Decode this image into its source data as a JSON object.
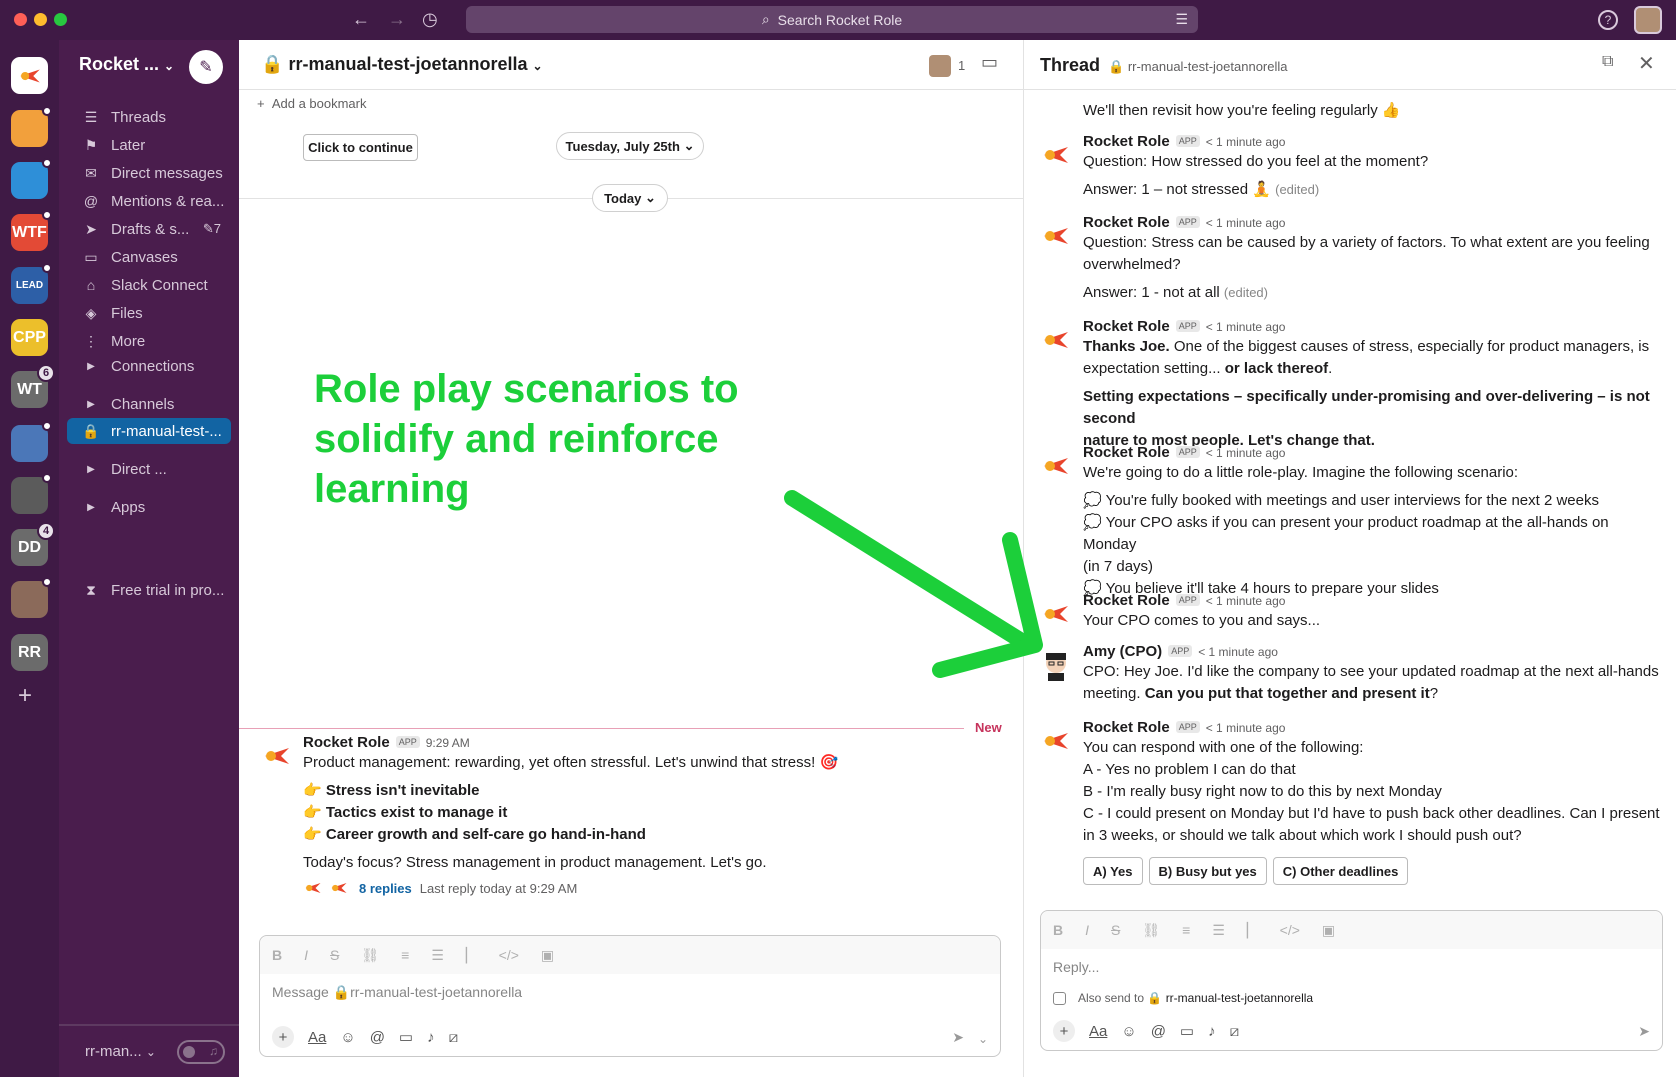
{
  "window": {
    "search_placeholder": "Search Rocket Role"
  },
  "rail": {
    "workspaces": [
      {
        "label": "",
        "color": "#d3382c"
      },
      {
        "label": "",
        "color": "#f2a03c"
      },
      {
        "label": "",
        "color": "#2e8fd8"
      },
      {
        "label": "WTF",
        "color": "#e34a36"
      },
      {
        "label": "LEAD",
        "color": "#2d5fa7"
      },
      {
        "label": "CPP",
        "color": "#ecbf2b"
      },
      {
        "label": "WT",
        "color": "#6b6b6b",
        "badge": "6"
      },
      {
        "label": "",
        "color": "#4b77b8"
      },
      {
        "label": "",
        "color": "#5b5b5b"
      },
      {
        "label": "DD",
        "color": "#6b6b6b",
        "badge": "4"
      },
      {
        "label": "",
        "color": "#8b6a5a"
      },
      {
        "label": "RR",
        "color": "#6b6b6b"
      }
    ],
    "add_label": "+"
  },
  "sidebar": {
    "workspace_name": "Rocket ...",
    "items": [
      {
        "label": "Threads",
        "icon": "threads-icon"
      },
      {
        "label": "Later",
        "icon": "bookmark-icon"
      },
      {
        "label": "Direct messages",
        "icon": "dm-icon"
      },
      {
        "label": "Mentions & rea...",
        "icon": "at-icon"
      },
      {
        "label": "Drafts & s...",
        "icon": "send-icon",
        "trail": "7"
      },
      {
        "label": "Canvases",
        "icon": "canvas-icon"
      },
      {
        "label": "Slack Connect",
        "icon": "building-icon"
      },
      {
        "label": "Files",
        "icon": "layers-icon"
      },
      {
        "label": "More",
        "icon": "more-icon"
      }
    ],
    "sections": [
      {
        "label": "Connections"
      },
      {
        "label": "Channels"
      },
      {
        "label": "rr-manual-test-...",
        "active": true
      },
      {
        "label": "Direct ..."
      },
      {
        "label": "Apps"
      }
    ],
    "trial": "Free trial in pro...",
    "footer_label": "rr-man..."
  },
  "channel": {
    "title": "rr-manual-test-joetannorella",
    "member_count": "1",
    "add_bookmark": "Add a bookmark",
    "click_continue": "Click to continue",
    "date_pill": "Tuesday, July 25th",
    "today_pill": "Today",
    "new_label": "New",
    "overlay_text": [
      "Role play scenarios to",
      "solidify and reinforce",
      "learning"
    ],
    "message": {
      "name": "Rocket Role",
      "app": "APP",
      "time": "9:29 AM",
      "line1": "Product management: rewarding, yet often stressful. Let's unwind that stress! 🎯",
      "bullets": [
        "Stress isn't inevitable",
        "Tactics exist to manage it",
        "Career growth and self-care go hand-in-hand"
      ],
      "bullet_emoji": "👉",
      "line2": "Today's focus? Stress management in product management. Let's go.",
      "replies": "8 replies",
      "last_reply": "Last reply today at 9:29 AM"
    },
    "composer_placeholder": "Message 🔒rr-manual-test-joetannorella"
  },
  "thread": {
    "title": "Thread",
    "channel": "rr-manual-test-joetannorella",
    "intro": "We'll then revisit how you're feeling regularly 👍",
    "messages": [
      {
        "name": "Rocket Role",
        "time": "< 1 minute ago",
        "lines": [
          "Question: How stressed do you feel at the moment?"
        ],
        "answer": "Answer: 1 – not stressed 🧘",
        "edited": "(edited)"
      },
      {
        "name": "Rocket Role",
        "time": "< 1 minute ago",
        "lines": [
          "Question: Stress can be caused by a variety of factors. To what extent are you feeling",
          "overwhelmed?"
        ],
        "answer": "Answer: 1 - not at all",
        "edited": "(edited)"
      },
      {
        "name": "Rocket Role",
        "time": "< 1 minute ago",
        "bold1": "Thanks Joe.",
        "rest1": " One of the biggest causes of stress, especially for product managers, is",
        "line2a": "expectation setting... ",
        "bold2": "or lack thereof",
        "line2b": ".",
        "boldpara": [
          "Setting expectations – specifically under-promising and over-delivering – is not second",
          "nature to most people. Let's change that."
        ]
      },
      {
        "name": "Rocket Role",
        "time": "< 1 minute ago",
        "lines": [
          "We're going to do a little role-play. Imagine the following scenario:"
        ],
        "scenario": [
          "💭 You're fully booked with meetings and user interviews for the next 2 weeks",
          "💭 Your CPO asks if you can present your product roadmap at the all-hands on Monday",
          "(in 7 days)",
          "💭 You believe it'll take 4 hours to prepare your slides"
        ]
      },
      {
        "name": "Rocket Role",
        "time": "< 1 minute ago",
        "lines": [
          "Your CPO comes to you and says..."
        ]
      },
      {
        "name": "Amy (CPO)",
        "time": "< 1 minute ago",
        "line1": "CPO: Hey Joe. I'd like the company to see your updated roadmap at the next all-hands",
        "line2a": "meeting. ",
        "bold2": "Can you put that together and present it",
        "line2b": "?"
      },
      {
        "name": "Rocket Role",
        "time": "< 1 minute ago",
        "lines": [
          "You can respond with one of the following:",
          "A - Yes no problem I can do that",
          "B - I'm really busy right now to do this by next Monday",
          "C - I could present on Monday but I'd have to push back other deadlines. Can I present",
          "in 3 weeks, or should we talk about which work I should push out?"
        ]
      }
    ],
    "app": "APP",
    "choices": [
      "A) Yes",
      "B) Busy but yes",
      "C) Other deadlines"
    ],
    "reply_placeholder": "Reply...",
    "also_send": "Also send to",
    "also_channel": "rr-manual-test-joetannorella"
  }
}
